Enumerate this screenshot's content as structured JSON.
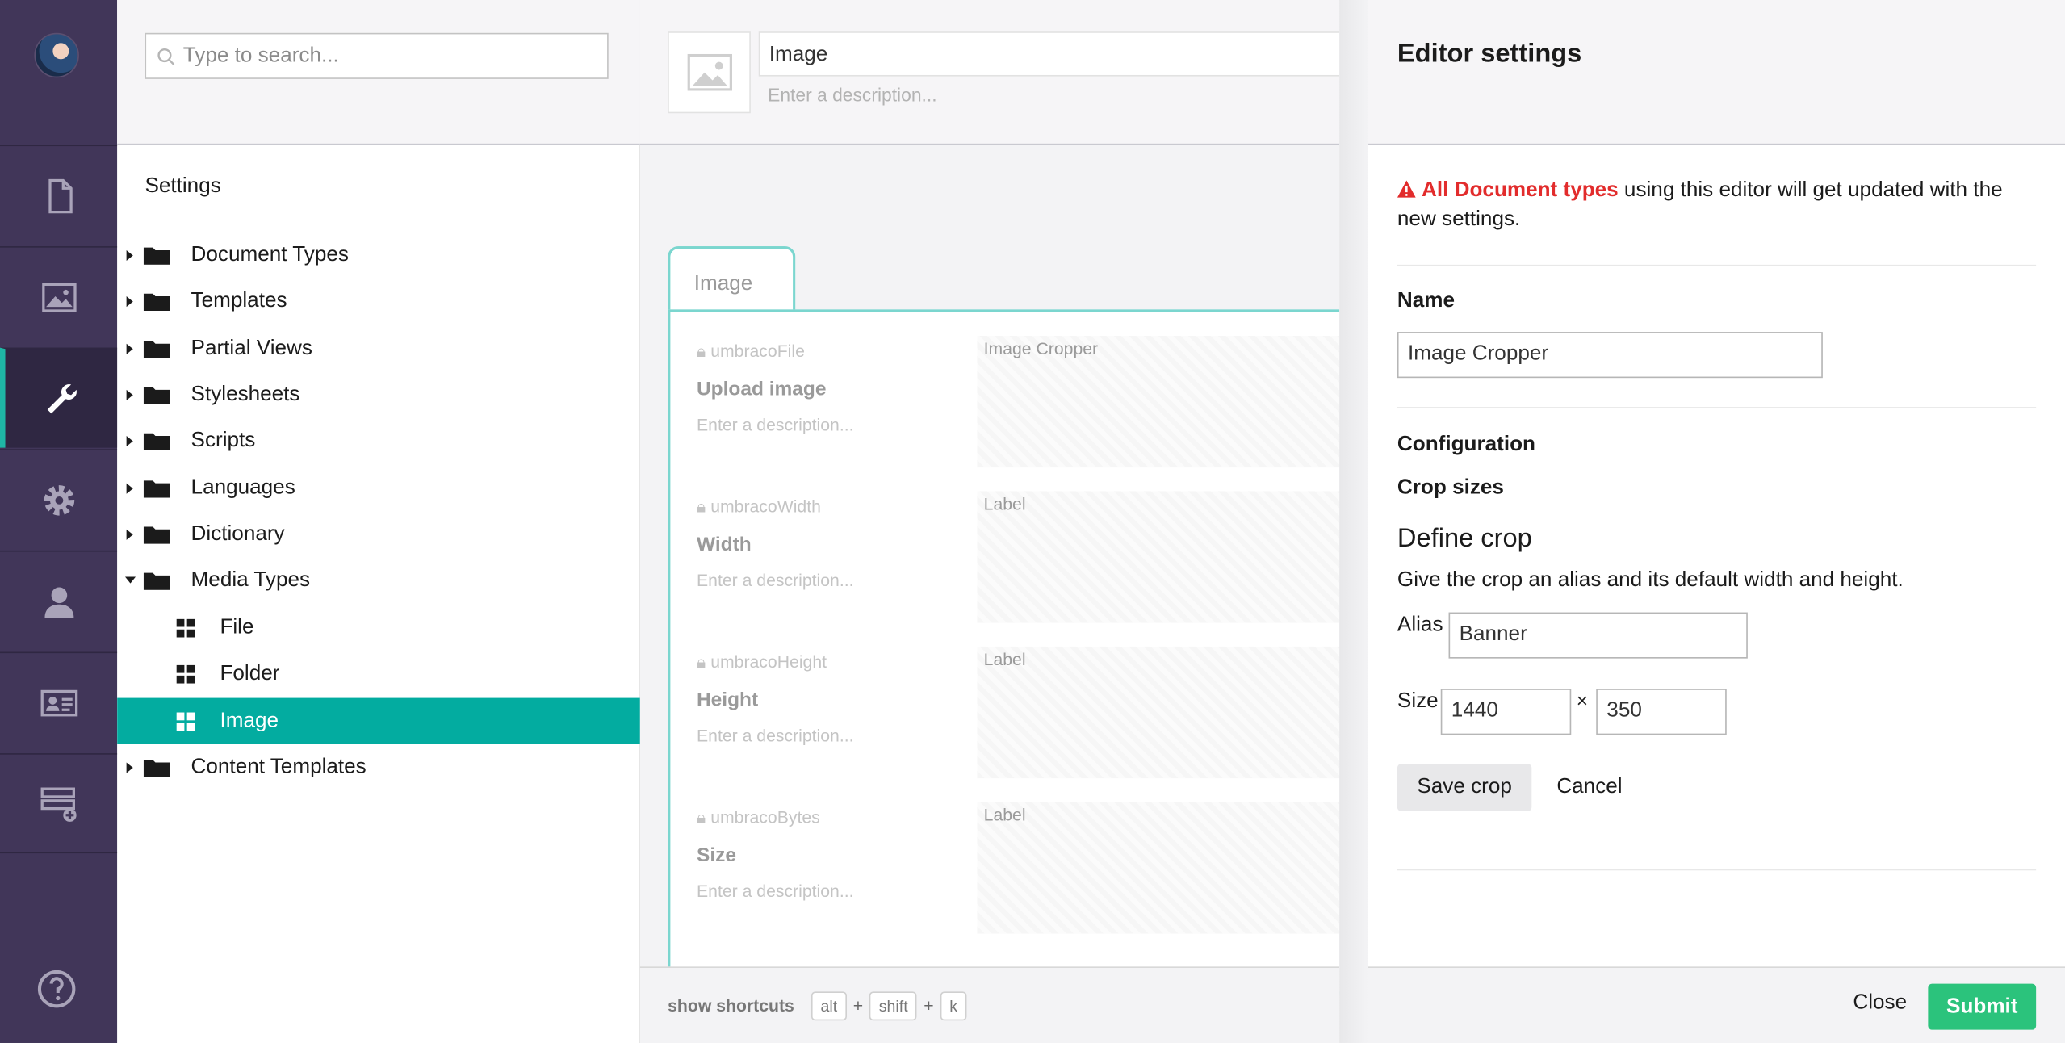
{
  "search": {
    "placeholder": "Type to search..."
  },
  "tree": {
    "section_title": "Settings",
    "nodes": [
      {
        "label": "Document Types"
      },
      {
        "label": "Templates"
      },
      {
        "label": "Partial Views"
      },
      {
        "label": "Stylesheets"
      },
      {
        "label": "Scripts"
      },
      {
        "label": "Languages"
      },
      {
        "label": "Dictionary"
      },
      {
        "label": "Media Types"
      },
      {
        "label": "File"
      },
      {
        "label": "Folder"
      },
      {
        "label": "Image"
      },
      {
        "label": "Content Templates"
      }
    ]
  },
  "editor": {
    "name_value": "Image",
    "description_placeholder": "Enter a description...",
    "tab_label": "Image",
    "properties": [
      {
        "alias": "umbracoFile",
        "name": "Upload image",
        "description": "Enter a description...",
        "type": "Image Cropper"
      },
      {
        "alias": "umbracoWidth",
        "name": "Width",
        "description": "Enter a description...",
        "type": "Label"
      },
      {
        "alias": "umbracoHeight",
        "name": "Height",
        "description": "Enter a description...",
        "type": "Label"
      },
      {
        "alias": "umbracoBytes",
        "name": "Size",
        "description": "Enter a description...",
        "type": "Label"
      }
    ],
    "footer": {
      "show_shortcuts": "show shortcuts",
      "key1": "alt",
      "key2": "shift",
      "key3": "k",
      "plus": "+"
    }
  },
  "panel": {
    "title": "Editor settings",
    "warning_highlight": "All Document types",
    "warning_rest": " using this editor will get updated with the new settings.",
    "name_label": "Name",
    "name_value": "Image Cropper",
    "configuration_label": "Configuration",
    "crop_sizes_label": "Crop sizes",
    "define_crop_title": "Define crop",
    "define_crop_help": "Give the crop an alias and its default width and height.",
    "alias_label": "Alias",
    "alias_value": "Banner",
    "size_label": "Size",
    "width_value": "1440",
    "height_value": "350",
    "times": "×",
    "save_crop": "Save crop",
    "cancel": "Cancel",
    "close": "Close",
    "submit": "Submit"
  },
  "colors": {
    "rail": "#413659",
    "selected": "#03aca0",
    "submit": "#2bc37c",
    "warning": "#e22c2c"
  }
}
